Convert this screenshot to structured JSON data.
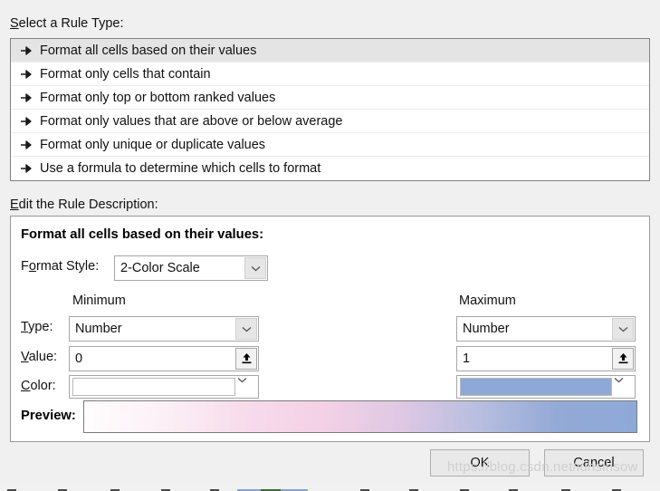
{
  "dialog": {
    "rule_type_label": "Select a Rule Type:",
    "rule_type_label_accel": "S",
    "rule_type_label_rest": "elect a Rule Type:",
    "edit_desc_label": "Edit the Rule Description:",
    "edit_desc_accel": "E",
    "edit_desc_rest": "dit the Rule Description:"
  },
  "rule_types": {
    "selected_index": 0,
    "items": [
      {
        "label": "Format all cells based on their values",
        "icon": "arrow-bullet-icon"
      },
      {
        "label": "Format only cells that contain",
        "icon": "arrow-bullet-icon"
      },
      {
        "label": "Format only top or bottom ranked values",
        "icon": "arrow-bullet-icon"
      },
      {
        "label": "Format only values that are above or below average",
        "icon": "arrow-bullet-icon"
      },
      {
        "label": "Format only unique or duplicate values",
        "icon": "arrow-bullet-icon"
      },
      {
        "label": "Use a formula to determine which cells to format",
        "icon": "arrow-bullet-icon"
      }
    ]
  },
  "rule_description": {
    "title": "Format all cells based on their values:",
    "format_style": {
      "label_accel": "o",
      "label_pre": "F",
      "label_post": "rmat Style:",
      "label_full": "Format Style:",
      "value": "2-Color Scale",
      "dropdown_icon": "chevron-down-icon"
    },
    "columns": [
      {
        "header": "Minimum"
      },
      {
        "header": "Maximum"
      }
    ],
    "rows": {
      "type": {
        "label_accel": "T",
        "label_pre": "",
        "label_post": "ype:",
        "label_full": "Type:",
        "minimum_value": "Number",
        "maximum_value": "Number",
        "dropdown_icon": "chevron-down-icon"
      },
      "value": {
        "label_accel": "V",
        "label_pre": "",
        "label_post": "alue:",
        "label_full": "Value:",
        "minimum_value": "0",
        "maximum_value": "1",
        "picker_icon": "collapse-dialog-icon"
      },
      "color": {
        "label_accel": "C",
        "label_pre": "",
        "label_post": "olor:",
        "label_full": "Color:",
        "minimum_color": "#FFFFFF",
        "maximum_color": "#8EA9D8",
        "dropdown_icon": "chevron-down-icon"
      }
    },
    "preview": {
      "label": "Preview:",
      "gradient_stops": [
        "#FFFDFE",
        "#FCF0F6",
        "#F7DCEC",
        "#F4D1E6",
        "#DFC8E4",
        "#B8BEDF",
        "#93A9D6",
        "#8EA9D8"
      ]
    }
  },
  "buttons": {
    "ok": "OK",
    "cancel": "Cancel"
  },
  "watermark": {
    "text": "https://blog.csdn.net/iuhsihsow"
  }
}
